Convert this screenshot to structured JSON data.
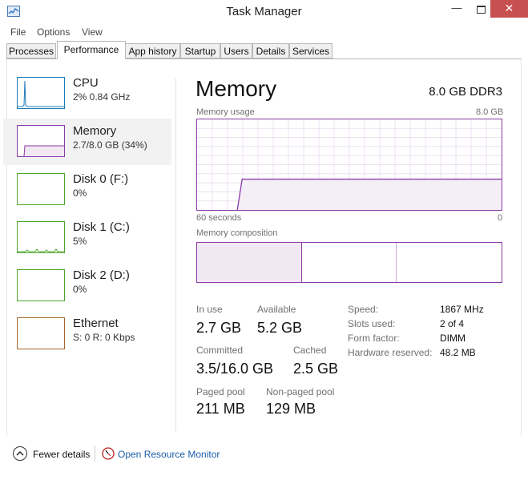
{
  "window": {
    "title": "Task Manager",
    "minimize_label": "—",
    "close_label": "✕"
  },
  "menu": [
    "File",
    "Options",
    "View"
  ],
  "tabs": [
    {
      "label": "Processes"
    },
    {
      "label": "Performance",
      "active": true
    },
    {
      "label": "App history"
    },
    {
      "label": "Startup"
    },
    {
      "label": "Users"
    },
    {
      "label": "Details"
    },
    {
      "label": "Services"
    }
  ],
  "sidebar": {
    "items": [
      {
        "name": "CPU",
        "sub": "2% 0.84 GHz",
        "color": "#1c7ab8"
      },
      {
        "name": "Memory",
        "sub": "2.7/8.0 GB (34%)",
        "color": "#8b3aa7",
        "selected": true
      },
      {
        "name": "Disk 0 (F:)",
        "sub": "0%",
        "color": "#4da52a"
      },
      {
        "name": "Disk 1 (C:)",
        "sub": "5%",
        "color": "#4da52a"
      },
      {
        "name": "Disk 2 (D:)",
        "sub": "0%",
        "color": "#4da52a"
      },
      {
        "name": "Ethernet",
        "sub": "S: 0 R: 0 Kbps",
        "color": "#a7652a"
      }
    ]
  },
  "detail": {
    "title": "Memory",
    "spec": "8.0 GB DDR3",
    "usage_label": "Memory usage",
    "usage_max": "8.0 GB",
    "time_left": "60 seconds",
    "time_right": "0",
    "composition_label": "Memory composition",
    "usage_level": 0.34,
    "stats": {
      "in_use_label": "In use",
      "in_use": "2.7 GB",
      "available_label": "Available",
      "available": "5.2 GB",
      "committed_label": "Committed",
      "committed": "3.5/16.0 GB",
      "cached_label": "Cached",
      "cached": "2.5 GB",
      "paged_pool_label": "Paged pool",
      "paged_pool": "211 MB",
      "nonpaged_pool_label": "Non-paged pool",
      "nonpaged_pool": "129 MB"
    },
    "specs": [
      {
        "label": "Speed:",
        "value": "1867 MHz"
      },
      {
        "label": "Slots used:",
        "value": "2 of 4"
      },
      {
        "label": "Form factor:",
        "value": "DIMM"
      },
      {
        "label": "Hardware reserved:",
        "value": "48.2 MB"
      }
    ],
    "accent": "#8b3aa7",
    "fill": "#f4eef6"
  },
  "footer": {
    "fewer_details": "Fewer details",
    "resource_monitor": "Open Resource Monitor"
  }
}
